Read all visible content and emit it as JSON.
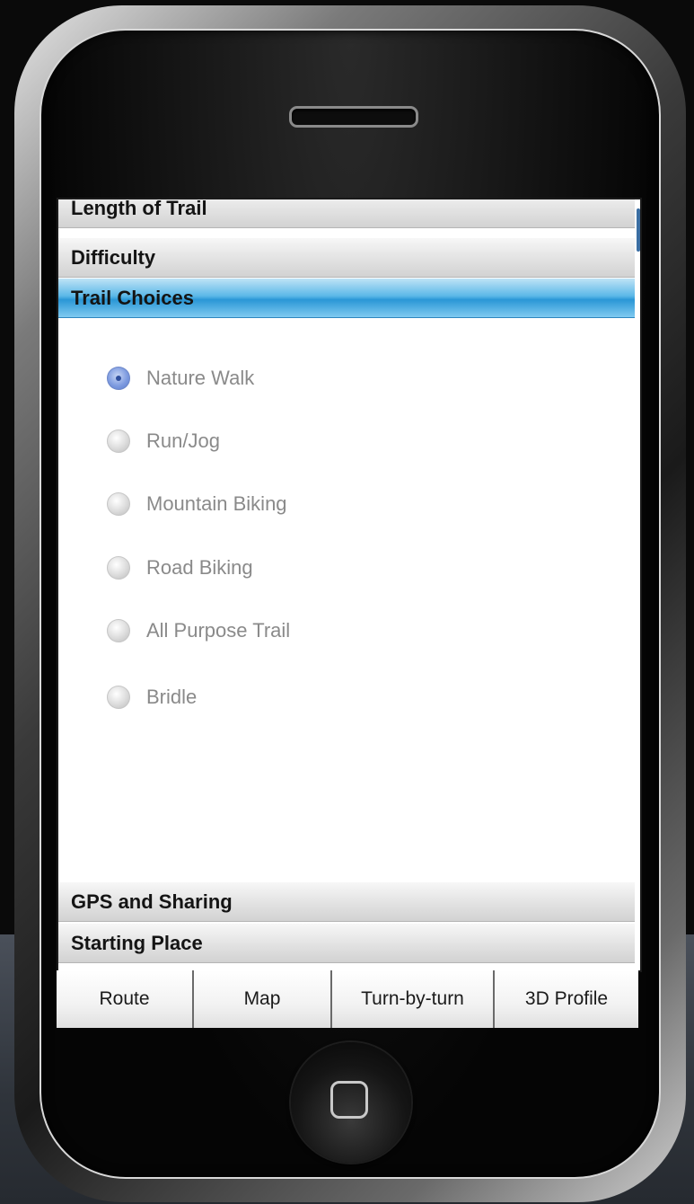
{
  "accordion": {
    "headers": [
      {
        "label": "Length of Trail"
      },
      {
        "label": "Difficulty"
      },
      {
        "label": "Trail Choices"
      },
      {
        "label": "GPS and Sharing"
      },
      {
        "label": "Starting Place"
      }
    ],
    "active_section": "Trail Choices"
  },
  "trail_choices": {
    "selected": "Nature Walk",
    "options": [
      {
        "label": "Nature Walk",
        "checked": true
      },
      {
        "label": "Run/Jog",
        "checked": false
      },
      {
        "label": "Mountain Biking",
        "checked": false
      },
      {
        "label": "Road Biking",
        "checked": false
      },
      {
        "label": "All Purpose Trail",
        "checked": false
      },
      {
        "label": "Bridle",
        "checked": false
      }
    ]
  },
  "tabs": [
    {
      "label": "Route"
    },
    {
      "label": "Map"
    },
    {
      "label": "Turn-by-turn"
    },
    {
      "label": "3D Profile"
    }
  ],
  "colors": {
    "active_header": "#2a97d6",
    "selected_radio": "#5a7bcc"
  },
  "icons": {
    "home": "home-button-icon",
    "speaker": "earpiece-speaker"
  }
}
